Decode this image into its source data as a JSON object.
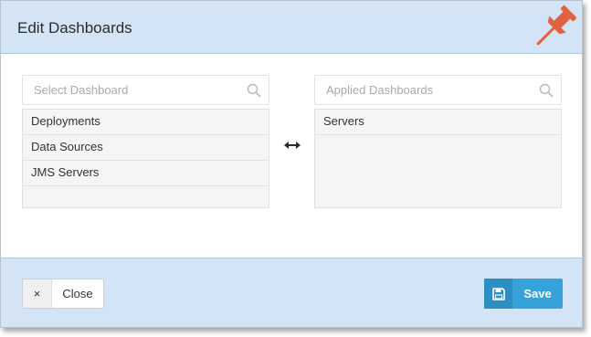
{
  "dialog": {
    "title": "Edit Dashboards"
  },
  "icons": {
    "pin": "pushpin-icon",
    "search": "search-icon",
    "transfer": "left-right-arrow-icon",
    "close": "close-icon",
    "save": "floppy-disk-icon"
  },
  "colors": {
    "header_bg": "#d3e4f7",
    "pin": "#e0623f",
    "save_button": "#35a3da"
  },
  "available": {
    "placeholder": "Select Dashboard",
    "items": [
      "Deployments",
      "Data Sources",
      "JMS Servers"
    ]
  },
  "applied": {
    "placeholder": "Applied Dashboards",
    "items": [
      "Servers"
    ]
  },
  "footer": {
    "close_icon": "×",
    "close_label": "Close",
    "save_label": "Save"
  }
}
